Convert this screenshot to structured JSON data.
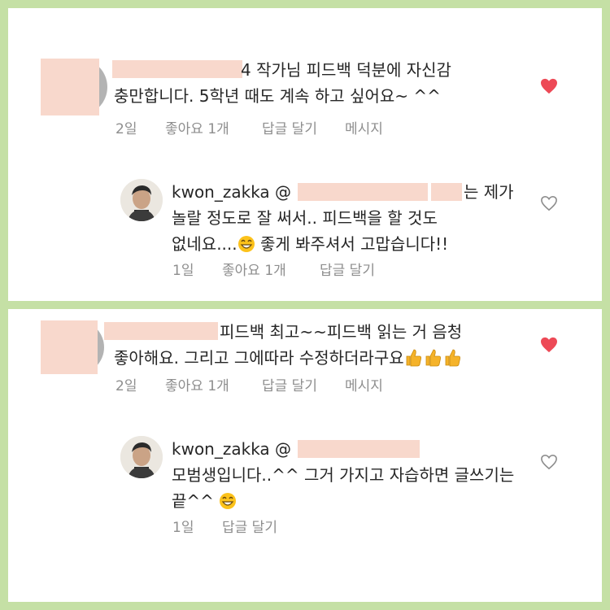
{
  "panels": [
    {
      "comment": {
        "line1_suffix": "4 작가님 피드백 덕분에 자신감",
        "line2": "충만합니다. 5학년 때도 계속 하고 싶어요~ ^^",
        "age": "2일",
        "likes": "좋아요 1개",
        "reply": "답글 달기",
        "message": "메시지"
      },
      "reply": {
        "username": "kwon_zakka",
        "mention_at": "@",
        "line1_suffix": "는 제가",
        "line2": "놀랄 정도로 잘 써서.. 피드백을 할 것도",
        "line3_text": "없네요....",
        "line3_after": " 좋게 봐주셔서 고맙습니다!!",
        "age": "1일",
        "likes": "좋아요 1개",
        "reply": "답글 달기"
      }
    },
    {
      "comment": {
        "line1_suffix": "피드백 최고~~피드백 읽는 거 음청",
        "line2_text": "좋아해요. 그리고 그에따라 수정하더라구요",
        "age": "2일",
        "likes": "좋아요 1개",
        "reply": "답글 달기",
        "message": "메시지"
      },
      "reply": {
        "username": "kwon_zakka",
        "mention_at": "@",
        "line2": "모범생입니다..^^ 그거 가지고 자습하면 글쓰기는",
        "line3_text": "끝^^",
        "age": "1일",
        "reply": "답글 달기"
      }
    }
  ],
  "colors": {
    "background": "#c5e0a5",
    "heart_red": "#ed4956",
    "meta_gray": "#8e8e8e",
    "redaction": "#f8d8cc"
  },
  "icons": [
    "heart-filled-icon",
    "heart-outline-icon",
    "grinning-emoji-icon",
    "thumbs-up-emoji-icon"
  ]
}
